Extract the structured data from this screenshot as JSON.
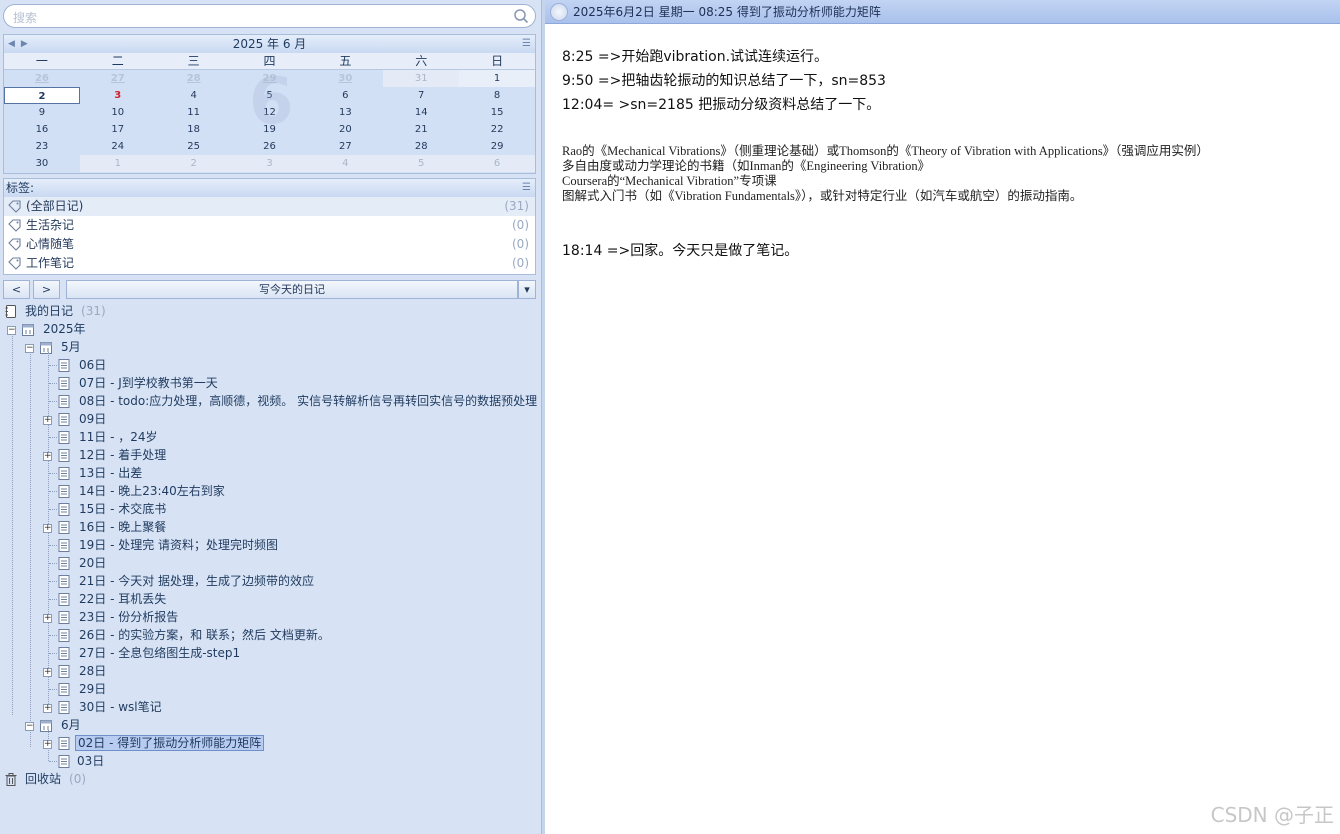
{
  "search": {
    "placeholder": "搜索"
  },
  "calendar": {
    "title": "2025 年 6 月",
    "weekdays": [
      "一",
      "二",
      "三",
      "四",
      "五",
      "六",
      "日"
    ],
    "watermark": "6",
    "rows": [
      [
        "26",
        "27",
        "28",
        "29",
        "30",
        "31",
        "1"
      ],
      [
        "2",
        "3",
        "4",
        "5",
        "6",
        "7",
        "8"
      ],
      [
        "9",
        "10",
        "11",
        "12",
        "13",
        "14",
        "15"
      ],
      [
        "16",
        "17",
        "18",
        "19",
        "20",
        "21",
        "22"
      ],
      [
        "23",
        "24",
        "25",
        "26",
        "27",
        "28",
        "29"
      ],
      [
        "30",
        "1",
        "2",
        "3",
        "4",
        "5",
        "6"
      ]
    ]
  },
  "tags": {
    "title": "标签:",
    "items": [
      {
        "label": "(全部日记)",
        "count": "(31)"
      },
      {
        "label": "生活杂记",
        "count": "(0)"
      },
      {
        "label": "心情随笔",
        "count": "(0)"
      },
      {
        "label": "工作笔记",
        "count": "(0)"
      }
    ]
  },
  "toolbar": {
    "prev": "<",
    "next": ">",
    "write_today": "写今天的日记"
  },
  "tree": {
    "root_label": "我的日记",
    "root_count": "(31)",
    "year": "2025年",
    "may": "5月",
    "june": "6月",
    "trash_label": "回收站",
    "trash_count": "(0)",
    "may_entries": [
      "06日",
      "07日 - J到学校教书第一天",
      "08日 - todo:应力处理，高顺德，视频。 实信号转解析信号再转回实信号的数据预处理",
      "09日",
      "11日 -         ，24岁",
      "12日 - 着手处理",
      "13日 - 出差",
      "14日 - 晚上23:40左右到家",
      "15日 -          术交底书",
      "16日 - 晚上聚餐",
      "19日 - 处理完       请资料；处理完时频图",
      "20日",
      "21日 - 今天对       据处理，生成了边频带的效应",
      "22日 - 耳机丢失",
      "23日 -       份分析报告",
      "26日 -      的实验方案，和      联系；然后     文档更新。",
      "27日 - 全息包络图生成-step1",
      "28日",
      "29日",
      "30日 - wsl笔记"
    ],
    "june_entries": [
      "02日 - 得到了振动分析师能力矩阵",
      "03日"
    ]
  },
  "header": {
    "title": "2025年6月2日 星期一 08:25   得到了振动分析师能力矩阵"
  },
  "content": {
    "line1": "8:25 =>开始跑vibration.试试连续运行。",
    "line2": "9:50 =>把轴齿轮振动的知识总结了一下，sn=853",
    "line3": "12:04= >sn=2185 把振动分级资料总结了一下。",
    "ref1": "Rao的《Mechanical Vibrations》（侧重理论基础）或Thomson的《Theory of Vibration with Applications》（强调应用实例）",
    "ref2": "多自由度或动力学理论的书籍（如Inman的《Engineering Vibration》",
    "ref3": "Coursera的“Mechanical Vibration”专项课",
    "ref4": "图解式入门书（如《Vibration Fundamentals》），或针对特定行业（如汽车或航空）的振动指南。",
    "line4": "18:14 =>回家。今天只是做了笔记。"
  },
  "watermark": "CSDN @子正"
}
